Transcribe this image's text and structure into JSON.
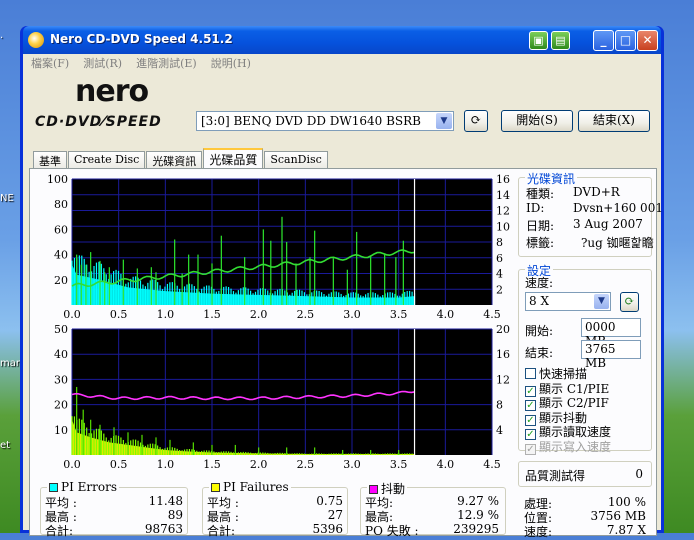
{
  "desktop": {
    "labels": [
      "NE",
      "mart",
      "et"
    ]
  },
  "window": {
    "title": "Nero CD-DVD Speed 4.51.2"
  },
  "menu": [
    "檔案(F)",
    "測試(R)",
    "進階測試(E)",
    "說明(H)"
  ],
  "logo": {
    "brand": "nero",
    "sub": "CD·DVD⁄SPEED"
  },
  "drive": {
    "value": "[3:0]   BENQ DVD DD DW1640 BSRB"
  },
  "buttons": {
    "start": "開始(S)",
    "end": "結束(X)"
  },
  "tabs": [
    {
      "label": "基準"
    },
    {
      "label": "Create Disc"
    },
    {
      "label": "光碟資訊"
    },
    {
      "label": "光碟品質",
      "active": true
    },
    {
      "label": "ScanDisc"
    }
  ],
  "disc_info": {
    "title": "光碟資訊",
    "type_label": "種類:",
    "type_value": "DVD+R",
    "id_label": "ID:",
    "id_value": "Dvsn+160 001",
    "date_label": "日期:",
    "date_value": "3 Aug 2007",
    "tag_label": "標籤:",
    "tag_value": "?ug 铷暱핥瞻"
  },
  "settings": {
    "title": "設定",
    "speed_label": "速度:",
    "speed_value": "8 X",
    "start_label": "開始:",
    "start_value": "0000 MB",
    "end_label": "結束:",
    "end_value": "3765 MB"
  },
  "checkboxes": [
    {
      "label": "快速掃描",
      "checked": false,
      "disabled": false
    },
    {
      "label": "顯示 C1/PIE",
      "checked": true,
      "disabled": false
    },
    {
      "label": "顯示 C2/PIF",
      "checked": true,
      "disabled": false
    },
    {
      "label": "顯示抖動",
      "checked": true,
      "disabled": false
    },
    {
      "label": "顯示讀取速度",
      "checked": true,
      "disabled": false
    },
    {
      "label": "顯示寫入速度",
      "checked": true,
      "disabled": true
    }
  ],
  "quality": {
    "label": "品質測試得",
    "value": "0"
  },
  "progress": {
    "proc_label": "處理:",
    "proc_value": "100 %",
    "pos_label": "位置:",
    "pos_value": "3756 MB",
    "speed_label": "速度:",
    "speed_value": "7.87 X"
  },
  "pi_errors": {
    "title": "PI Errors",
    "color": "#00ffff",
    "avg_label": "平均 :",
    "avg": "11.48",
    "max_label": "最高 :",
    "max": "89",
    "total_label": "合計:",
    "total": "98763"
  },
  "pi_failures": {
    "title": "PI Failures",
    "color": "#ffff00",
    "avg_label": "平均 :",
    "avg": "0.75",
    "max_label": "最高 :",
    "max": "27",
    "total_label": "合計:",
    "total": "5396"
  },
  "jitter": {
    "title": "抖動",
    "color": "#ff00ff",
    "avg_label": "平均:",
    "avg": "9.27 %",
    "max_label": "最高:",
    "max": "12.9 %",
    "po_label": "PO 失敗 :",
    "po": "239295"
  },
  "chart_data": [
    {
      "type": "area",
      "name": "top",
      "x_ticks": [
        "0.0",
        "0.5",
        "1.0",
        "1.5",
        "2.0",
        "2.5",
        "3.0",
        "3.5",
        "4.0",
        "4.5"
      ],
      "y_left_ticks": [
        "100",
        "80",
        "60",
        "40",
        "20"
      ],
      "y_right_ticks": [
        "16",
        "14",
        "12",
        "10",
        "8",
        "6",
        "4",
        "2"
      ],
      "xlim": [
        0,
        4.5
      ],
      "ylim_left": [
        0,
        100
      ],
      "ylim_right": [
        0,
        16
      ],
      "end_x": 3.67,
      "pie_profile": [
        [
          0,
          32
        ],
        [
          0.05,
          24
        ],
        [
          0.3,
          20
        ],
        [
          0.6,
          14
        ],
        [
          1.0,
          11
        ],
        [
          1.5,
          9
        ],
        [
          2.0,
          8
        ],
        [
          2.5,
          7
        ],
        [
          3.0,
          6
        ],
        [
          3.5,
          6
        ],
        [
          3.67,
          7
        ]
      ],
      "speed_line": [
        [
          0,
          2.4
        ],
        [
          3.67,
          6.9
        ]
      ],
      "spikes_pie": [
        [
          0.05,
          40
        ],
        [
          0.1,
          32
        ],
        [
          0.15,
          32
        ],
        [
          0.2,
          42
        ],
        [
          0.3,
          35
        ],
        [
          0.35,
          26
        ],
        [
          0.4,
          30
        ],
        [
          0.55,
          36
        ],
        [
          0.7,
          29
        ],
        [
          0.85,
          30
        ],
        [
          0.9,
          26
        ],
        [
          1.1,
          52
        ],
        [
          1.18,
          25
        ],
        [
          1.25,
          40
        ],
        [
          1.35,
          40
        ],
        [
          1.5,
          33
        ],
        [
          1.6,
          55
        ],
        [
          1.85,
          38
        ],
        [
          2.05,
          60
        ],
        [
          2.13,
          51
        ],
        [
          2.25,
          70
        ],
        [
          2.3,
          50
        ],
        [
          2.4,
          33
        ],
        [
          2.55,
          38
        ],
        [
          2.6,
          59
        ],
        [
          2.8,
          37
        ],
        [
          2.95,
          28
        ],
        [
          3.05,
          58
        ],
        [
          3.2,
          39
        ],
        [
          3.35,
          41
        ],
        [
          3.47,
          38
        ],
        [
          3.55,
          51
        ]
      ]
    },
    {
      "type": "area",
      "name": "bottom",
      "x_ticks": [
        "0.0",
        "0.5",
        "1.0",
        "1.5",
        "2.0",
        "2.5",
        "3.0",
        "3.5",
        "4.0",
        "4.5"
      ],
      "y_left_ticks": [
        "50",
        "40",
        "30",
        "20",
        "10"
      ],
      "y_right_ticks": [
        "20",
        "16",
        "12",
        "8",
        "4"
      ],
      "xlim": [
        0,
        4.5
      ],
      "ylim_left": [
        0,
        50
      ],
      "ylim_right": [
        0,
        20
      ],
      "end_x": 3.67,
      "jitter_line": [
        [
          0,
          9.6
        ],
        [
          0.5,
          9.0
        ],
        [
          1.0,
          9.1
        ],
        [
          1.5,
          9.0
        ],
        [
          2.0,
          9.0
        ],
        [
          2.5,
          9.2
        ],
        [
          3.0,
          9.4
        ],
        [
          3.5,
          9.8
        ],
        [
          3.67,
          10.2
        ]
      ],
      "pif_profile": [
        [
          0,
          14
        ],
        [
          0.05,
          9
        ],
        [
          0.2,
          7
        ],
        [
          0.4,
          5
        ],
        [
          0.6,
          4
        ],
        [
          0.8,
          3
        ],
        [
          1.0,
          2
        ],
        [
          1.2,
          1.5
        ],
        [
          1.5,
          1
        ],
        [
          2.0,
          0.6
        ],
        [
          2.5,
          0.4
        ],
        [
          3.0,
          0.4
        ],
        [
          3.67,
          0.4
        ]
      ],
      "spikes_pif": [
        [
          0.05,
          27
        ],
        [
          0.12,
          18
        ],
        [
          0.2,
          14
        ],
        [
          0.3,
          12
        ],
        [
          0.45,
          11
        ],
        [
          0.6,
          9
        ],
        [
          0.75,
          8
        ],
        [
          0.9,
          7
        ],
        [
          1.05,
          6
        ],
        [
          1.3,
          5
        ],
        [
          1.5,
          4
        ],
        [
          1.75,
          4
        ],
        [
          2.0,
          3
        ],
        [
          2.3,
          3
        ],
        [
          2.6,
          3
        ],
        [
          2.9,
          2
        ],
        [
          3.2,
          2
        ],
        [
          3.5,
          2
        ]
      ]
    }
  ]
}
